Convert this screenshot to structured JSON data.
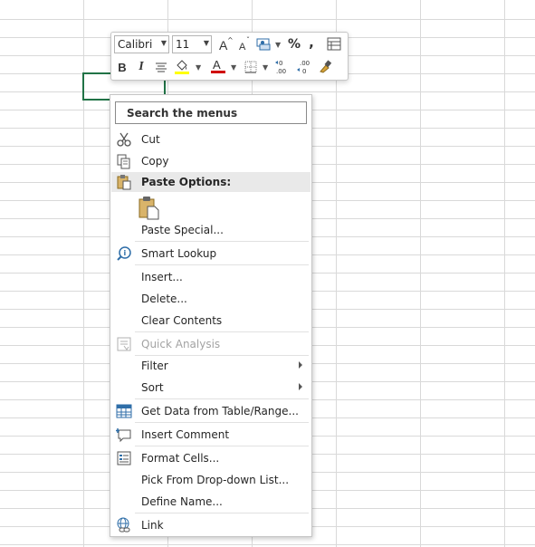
{
  "toolbar": {
    "font_name": "Calibri",
    "font_size": "11",
    "bold": "B",
    "italic": "I",
    "percent": "%",
    "comma": ","
  },
  "menu": {
    "search_placeholder": "Search the menus",
    "items": {
      "cut": "Cut",
      "copy": "Copy",
      "paste_options": "Paste Options:",
      "paste_special": "Paste Special...",
      "smart_lookup": "Smart Lookup",
      "insert": "Insert...",
      "delete": "Delete...",
      "clear_contents": "Clear Contents",
      "quick_analysis": "Quick Analysis",
      "filter": "Filter",
      "sort": "Sort",
      "get_data": "Get Data from Table/Range...",
      "insert_comment": "Insert Comment",
      "format_cells": "Format Cells...",
      "pick_from_list": "Pick From Drop-down List...",
      "define_name": "Define Name...",
      "link": "Link"
    }
  },
  "colors": {
    "accent": "#217346",
    "highlight": "#ffff00",
    "font_color": "#d00000",
    "grid": "#d4d4d4"
  }
}
